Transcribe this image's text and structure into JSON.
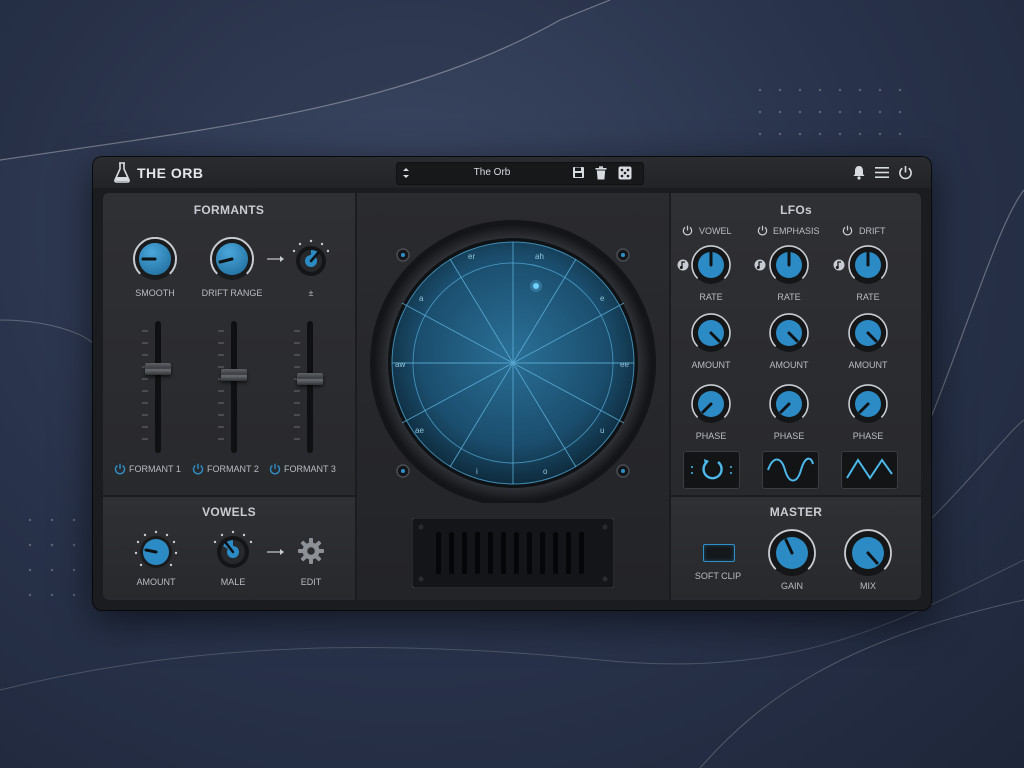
{
  "app": {
    "title": "THE ORB",
    "preset_name": "The Orb",
    "accent_color": "#2f8fc7"
  },
  "toolbar": {
    "icons": [
      "flask-icon",
      "preset-arrows-icon",
      "save-icon",
      "trash-icon",
      "dice-icon",
      "bell-icon",
      "menu-icon",
      "power-icon"
    ]
  },
  "formants": {
    "header": "FORMANTS",
    "knobs": [
      {
        "label": "SMOOTH"
      },
      {
        "label": "DRIFT RANGE"
      },
      {
        "label": "±"
      }
    ],
    "faders": [
      {
        "label": "FORMANT 1"
      },
      {
        "label": "FORMANT 2"
      },
      {
        "label": "FORMANT 3"
      }
    ]
  },
  "vowels": {
    "header": "VOWELS",
    "amount_label": "AMOUNT",
    "male_label": "MALE",
    "edit_label": "EDIT"
  },
  "orb": {
    "labels": [
      "er",
      "ah",
      "a",
      "e",
      "aw",
      "ee",
      "ae",
      "u",
      "i",
      "o"
    ]
  },
  "lfos": {
    "header": "LFOs",
    "columns": [
      {
        "name": "VOWEL",
        "rate_label": "RATE",
        "amount_label": "AMOUNT",
        "phase_label": "PHASE",
        "shape": "random"
      },
      {
        "name": "EMPHASIS",
        "rate_label": "RATE",
        "amount_label": "AMOUNT",
        "phase_label": "PHASE",
        "shape": "sine"
      },
      {
        "name": "DRIFT",
        "rate_label": "RATE",
        "amount_label": "AMOUNT",
        "phase_label": "PHASE",
        "shape": "triangle"
      }
    ]
  },
  "master": {
    "header": "MASTER",
    "soft_clip_label": "SOFT CLIP",
    "gain_label": "GAIN",
    "mix_label": "MIX"
  }
}
